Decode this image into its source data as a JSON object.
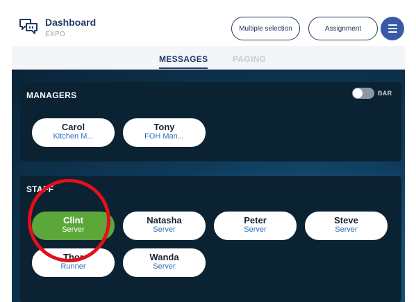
{
  "header": {
    "title": "Dashboard",
    "subtitle": "EXPO",
    "multiple_selection_label": "Multiple selection",
    "assignment_label": "Assignment"
  },
  "tabs": {
    "messages": "MESSAGES",
    "paging": "PAGING"
  },
  "managers": {
    "title": "MANAGERS",
    "toggle_label": "BAR",
    "toggle_on": false,
    "people": [
      {
        "name": "Carol",
        "role": "Kitchen M..."
      },
      {
        "name": "Tony",
        "role": "FOH Man..."
      }
    ]
  },
  "staff": {
    "title": "STAFF",
    "people": [
      {
        "name": "Clint",
        "role": "Server",
        "selected": true
      },
      {
        "name": "Natasha",
        "role": "Server"
      },
      {
        "name": "Peter",
        "role": "Server"
      },
      {
        "name": "Steve",
        "role": "Server"
      },
      {
        "name": "Thor",
        "role": "Runner"
      },
      {
        "name": "Wanda",
        "role": "Server"
      }
    ]
  },
  "colors": {
    "brand_navy": "#1f3a66",
    "menu_button": "#3a5aa8",
    "selected_chip": "#5ca73a",
    "role_text": "#2a6fb8",
    "annotation_circle": "#e30f1b"
  }
}
